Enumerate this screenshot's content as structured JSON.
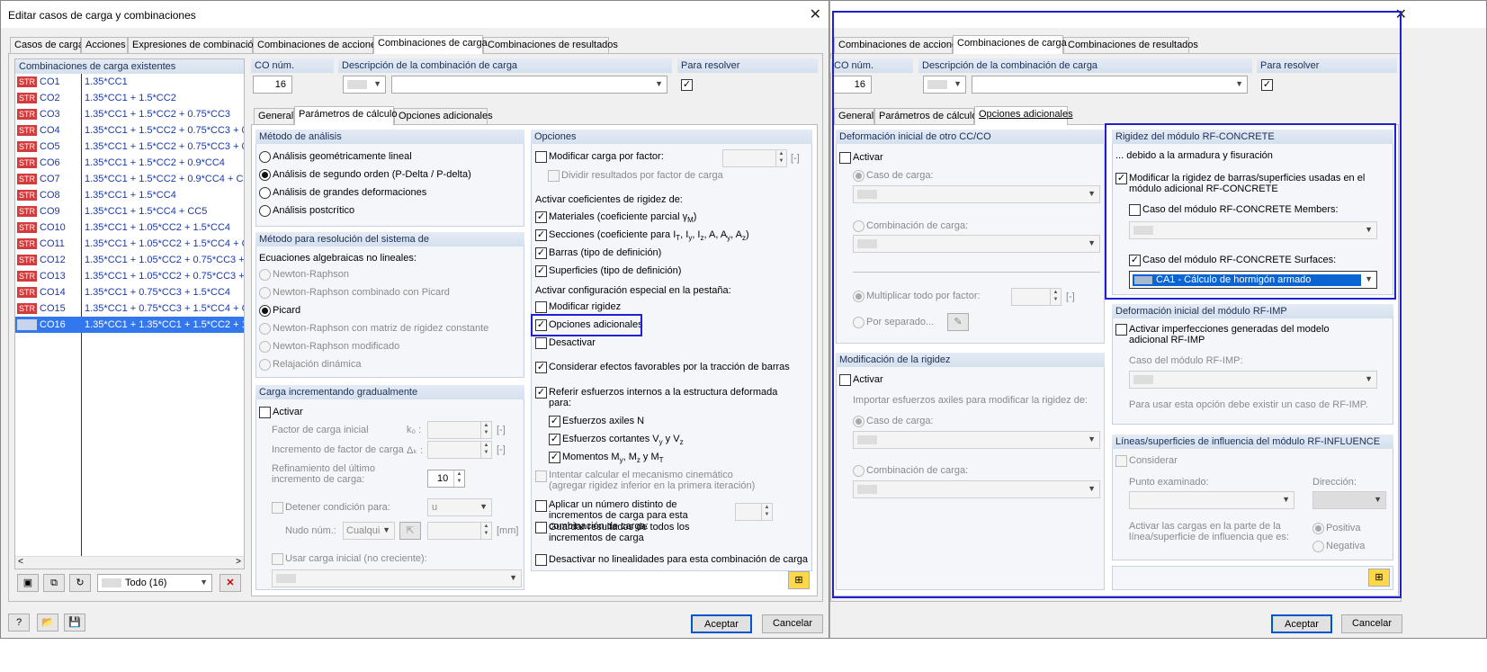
{
  "left_window": {
    "title": "Editar casos de carga y combinaciones",
    "tabs": [
      "Casos de carga",
      "Acciones",
      "Expresiones de combinación",
      "Combinaciones de acciones",
      "Combinaciones de carga",
      "Combinaciones de resultados"
    ],
    "list_header": "Combinaciones de carga existentes",
    "combos": [
      {
        "badge": "STR",
        "name": "CO1",
        "formula": "1.35*CC1"
      },
      {
        "badge": "STR",
        "name": "CO2",
        "formula": "1.35*CC1 + 1.5*CC2"
      },
      {
        "badge": "STR",
        "name": "CO3",
        "formula": "1.35*CC1 + 1.5*CC2 + 0.75*CC3"
      },
      {
        "badge": "STR",
        "name": "CO4",
        "formula": "1.35*CC1 + 1.5*CC2 + 0.75*CC3 + 0"
      },
      {
        "badge": "STR",
        "name": "CO5",
        "formula": "1.35*CC1 + 1.5*CC2 + 0.75*CC3 + 0"
      },
      {
        "badge": "STR",
        "name": "CO6",
        "formula": "1.35*CC1 + 1.5*CC2 + 0.9*CC4"
      },
      {
        "badge": "STR",
        "name": "CO7",
        "formula": "1.35*CC1 + 1.5*CC2 + 0.9*CC4 + CC"
      },
      {
        "badge": "STR",
        "name": "CO8",
        "formula": "1.35*CC1 + 1.5*CC4"
      },
      {
        "badge": "STR",
        "name": "CO9",
        "formula": "1.35*CC1 + 1.5*CC4 + CC5"
      },
      {
        "badge": "STR",
        "name": "CO10",
        "formula": "1.35*CC1 + 1.05*CC2 + 1.5*CC4"
      },
      {
        "badge": "STR",
        "name": "CO11",
        "formula": "1.35*CC1 + 1.05*CC2 + 1.5*CC4 + C"
      },
      {
        "badge": "STR",
        "name": "CO12",
        "formula": "1.35*CC1 + 1.05*CC2 + 0.75*CC3 +"
      },
      {
        "badge": "STR",
        "name": "CO13",
        "formula": "1.35*CC1 + 1.05*CC2 + 0.75*CC3 +"
      },
      {
        "badge": "STR",
        "name": "CO14",
        "formula": "1.35*CC1 + 0.75*CC3 + 1.5*CC4"
      },
      {
        "badge": "STR",
        "name": "CO15",
        "formula": "1.35*CC1 + 0.75*CC3 + 1.5*CC4 + C"
      },
      {
        "badge": "",
        "name": "CO16",
        "formula": "1.35*CC1 + 1.35*CC1 + 1.5*CC2 + 1"
      }
    ],
    "filter_value": "Todo (16)",
    "co_num_label": "CO núm.",
    "co_num_value": "16",
    "desc_label": "Descripción de la combinación de carga",
    "resolve_label": "Para resolver",
    "subtabs": [
      "General",
      "Parámetros de cálculo",
      "Opciones adicionales"
    ],
    "analysis": {
      "header": "Método de análisis",
      "options": [
        "Análisis geométricamente lineal",
        "Análisis de segundo orden (P-Delta / P-delta)",
        "Análisis de grandes deformaciones",
        "Análisis postcrítico"
      ]
    },
    "solver": {
      "header": "Método para resolución del sistema de",
      "sub": "Ecuaciones algebraicas no lineales:",
      "options": [
        "Newton-Raphson",
        "Newton-Raphson combinado con Picard",
        "Picard",
        "Newton-Raphson con matriz de rigidez constante",
        "Newton-Raphson modificado",
        "Relajación dinámica"
      ]
    },
    "incremental": {
      "header": "Carga incrementando gradualmente",
      "activate": "Activar",
      "initial_factor": "Factor de carga inicial",
      "k0": "k₀ :",
      "increment": "Incremento de factor de carga",
      "dk": "Δₖ :",
      "refine": "Refinamiento del último incremento de carga:",
      "refine_value": "10",
      "unit": "[-]",
      "stop": "Detener condición para:",
      "stop_value": "u",
      "node": "Nudo núm.:",
      "node_value": "Cualqui",
      "mm": "[mm]",
      "initial_load": "Usar carga inicial (no creciente):"
    },
    "options": {
      "header": "Opciones",
      "modify_by_factor": "Modificar carga por factor:",
      "unit": "[-]",
      "divide": "Dividir resultados por factor de carga",
      "stiff_title": "Activar coeficientes de rigidez de:",
      "materials": "Materiales (coeficiente parcial γ",
      "materials_sub": "M",
      "sections": "Secciones (coeficiente para I",
      "sections_tail": ", I",
      "members": "Barras (tipo de definición)",
      "surfaces": "Superficies (tipo de definición)",
      "special_title": "Activar configuración especial en la pestaña:",
      "modify_stiffness": "Modificar rigidez",
      "additional": "Opciones adicionales",
      "deactivate": "Desactivar",
      "favorable": "Considerar efectos favorables por la tracción de barras",
      "refer": "Referir esfuerzos internos a la estructura deformada para:",
      "axial": "Esfuerzos axiles N",
      "shear": "Esfuerzos cortantes V",
      "shear_tail": " y V",
      "moments": "Momentos M",
      "moments_tail": ", M",
      "kinematic": "Intentar calcular el mecanismo cinemático (agregar rigidez inferior en la primera iteración)",
      "distinct_inc": "Aplicar un número distinto de incrementos de carga para esta combinación de carga:",
      "save_results": "Guardar resultados de todos los incrementos de carga",
      "deactivate_nl": "Desactivar no linealidades para esta combinación de carga"
    },
    "ok": "Aceptar",
    "cancel": "Cancelar"
  },
  "right_window": {
    "tabs": [
      "Combinaciones de acciones",
      "Combinaciones de carga",
      "Combinaciones de resultados"
    ],
    "co_num_label": "CO núm.",
    "co_num_value": "16",
    "desc_label": "Descripción de la combinación de carga",
    "resolve_label": "Para resolver",
    "subtabs": [
      "General",
      "Parámetros de cálculo",
      "Opciones adicionales"
    ],
    "initial_def": {
      "header": "Deformación inicial de otro CC/CO",
      "activate": "Activar",
      "load_case": "Caso de carga:",
      "load_combo": "Combinación de carga:",
      "multiply": "Multiplicar todo por factor:",
      "unit": "[-]",
      "separate": "Por separado..."
    },
    "stiffness_mod": {
      "header": "Modificación de la rigidez",
      "activate": "Activar",
      "import": "Importar esfuerzos axiles para modificar la rigidez de:",
      "load_case": "Caso de carga:",
      "load_combo": "Combinación de carga:"
    },
    "rf_concrete": {
      "header": "Rigidez del módulo RF-CONCRETE",
      "due": "... debido a la armadura y fisuración",
      "modify": "Modificar la rigidez de barras/superficies usadas en el módulo adicional RF-CONCRETE",
      "members": "Caso del módulo RF-CONCRETE Members:",
      "surfaces": "Caso del módulo RF-CONCRETE Surfaces:",
      "surfaces_value": "CA1 - Cálculo de hormigón armado"
    },
    "rf_imp": {
      "header": "Deformación inicial del módulo RF-IMP",
      "activate": "Activar imperfecciones generadas del modelo adicional RF-IMP",
      "case": "Caso del módulo RF-IMP:",
      "note": "Para usar esta opción debe existir un caso de RF-IMP."
    },
    "rf_influence": {
      "header": "Líneas/superficies de influencia del módulo RF-INFLUENCE",
      "consider": "Considerar",
      "point": "Punto examinado:",
      "direction": "Dirección:",
      "activate_loads": "Activar las cargas en la parte de la línea/superficie de influencia que es:",
      "positive": "Positiva",
      "negative": "Negativa"
    },
    "ok": "Aceptar",
    "cancel": "Cancelar"
  }
}
